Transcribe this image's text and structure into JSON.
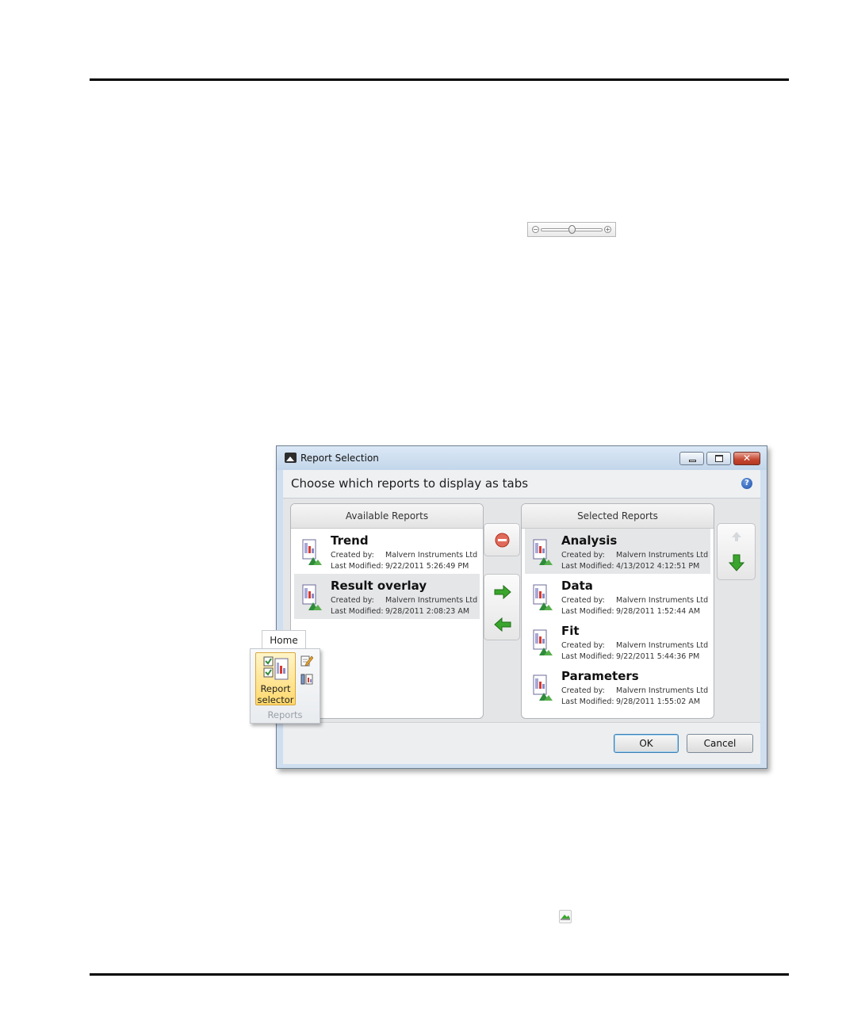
{
  "zoom_slider": {
    "level": 0.5
  },
  "dialog": {
    "title": "Report Selection",
    "header": "Choose which reports to display as tabs",
    "help_glyph": "?",
    "available": {
      "heading": "Available Reports",
      "items": [
        {
          "name": "Trend",
          "created_label": "Created by:",
          "created_by": "Malvern Instruments Ltd",
          "modified_label": "Last Modified:",
          "modified": "9/22/2011 5:26:49 PM"
        },
        {
          "name": "Result overlay",
          "created_label": "Created by:",
          "created_by": "Malvern Instruments Ltd",
          "modified_label": "Last Modified:",
          "modified": "9/28/2011 2:08:23 AM"
        }
      ]
    },
    "selected": {
      "heading": "Selected Reports",
      "items": [
        {
          "name": "Analysis",
          "created_label": "Created by:",
          "created_by": "Malvern Instruments Ltd",
          "modified_label": "Last Modified:",
          "modified": "4/13/2012 4:12:51 PM"
        },
        {
          "name": "Data",
          "created_label": "Created by:",
          "created_by": "Malvern Instruments Ltd",
          "modified_label": "Last Modified:",
          "modified": "9/28/2011 1:52:44 AM"
        },
        {
          "name": "Fit",
          "created_label": "Created by:",
          "created_by": "Malvern Instruments Ltd",
          "modified_label": "Last Modified:",
          "modified": "9/22/2011 5:44:36 PM"
        },
        {
          "name": "Parameters",
          "created_label": "Created by:",
          "created_by": "Malvern Instruments Ltd",
          "modified_label": "Last Modified:",
          "modified": "9/28/2011 1:55:02 AM"
        }
      ]
    },
    "buttons": {
      "ok": "OK",
      "cancel": "Cancel",
      "close_glyph": "✕"
    }
  },
  "ribbon": {
    "tab": "Home",
    "button_line1": "Report",
    "button_line2": "selector",
    "group": "Reports"
  },
  "colors": {
    "arrow_green": "#3aa52c",
    "remove_red": "#d2432f",
    "selection_gray": "#e5e6e8"
  }
}
